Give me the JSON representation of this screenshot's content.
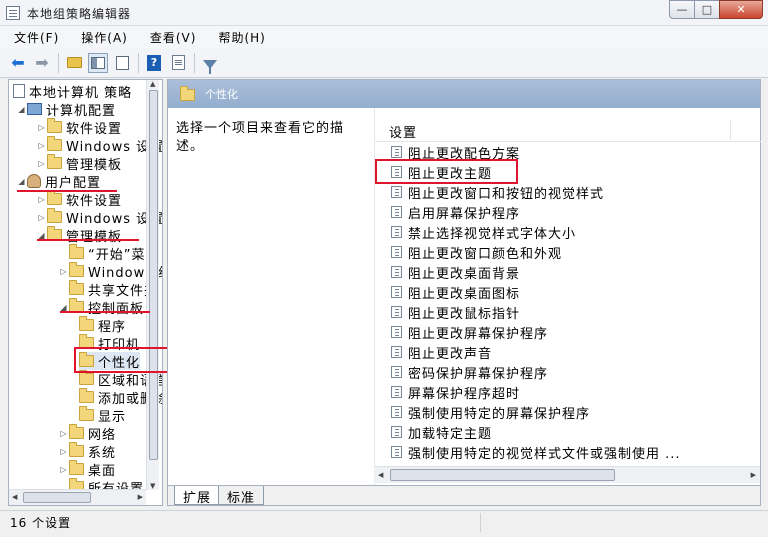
{
  "window": {
    "title": "本地组策略编辑器",
    "min_label": "—",
    "max_label": "□",
    "close_label": "✕"
  },
  "menubar": [
    "文件(F)",
    "操作(A)",
    "查看(V)",
    "帮助(H)"
  ],
  "toolbar": {
    "icons": [
      "back-arrow-icon",
      "forward-arrow-icon",
      "folder-up-icon",
      "show-hide-tree-icon",
      "export-list-icon",
      "help-icon",
      "properties-icon",
      "filter-icon"
    ]
  },
  "tree": {
    "items": [
      {
        "label": "本地计算机 策略",
        "depth": 0,
        "icon": "policy-doc-icon",
        "expander": "collapsed"
      },
      {
        "label": "计算机配置",
        "depth": 1,
        "icon": "computer-icon",
        "expander": "expanded"
      },
      {
        "label": "软件设置",
        "depth": 2,
        "icon": "folder-icon",
        "expander": "collapsed"
      },
      {
        "label": "Windows 设置",
        "depth": 2,
        "icon": "folder-icon",
        "expander": "collapsed"
      },
      {
        "label": "管理模板",
        "depth": 2,
        "icon": "folder-icon",
        "expander": "collapsed"
      },
      {
        "label": "用户配置",
        "depth": 1,
        "icon": "user-icon",
        "expander": "expanded"
      },
      {
        "label": "软件设置",
        "depth": 2,
        "icon": "folder-icon",
        "expander": "collapsed"
      },
      {
        "label": "Windows 设置",
        "depth": 2,
        "icon": "folder-icon",
        "expander": "collapsed"
      },
      {
        "label": "管理模板",
        "depth": 2,
        "icon": "folder-icon",
        "expander": "expanded"
      },
      {
        "label": "“开始”菜单",
        "depth": 3,
        "icon": "folder-icon",
        "expander": "none"
      },
      {
        "label": "Windows 组件",
        "depth": 3,
        "icon": "folder-icon",
        "expander": "collapsed"
      },
      {
        "label": "共享文件夹",
        "depth": 3,
        "icon": "folder-icon",
        "expander": "none"
      },
      {
        "label": "控制面板",
        "depth": 3,
        "icon": "folder-icon",
        "expander": "expanded"
      },
      {
        "label": "程序",
        "depth": 4,
        "icon": "folder-icon",
        "expander": "none"
      },
      {
        "label": "打印机",
        "depth": 4,
        "icon": "folder-icon",
        "expander": "none"
      },
      {
        "label": "个性化",
        "depth": 4,
        "icon": "folder-icon",
        "expander": "none"
      },
      {
        "label": "区域和语言",
        "depth": 4,
        "icon": "folder-icon",
        "expander": "none"
      },
      {
        "label": "添加或删除程序",
        "depth": 4,
        "icon": "folder-icon",
        "expander": "none"
      },
      {
        "label": "显示",
        "depth": 4,
        "icon": "folder-icon",
        "expander": "none"
      },
      {
        "label": "网络",
        "depth": 3,
        "icon": "folder-icon",
        "expander": "collapsed"
      },
      {
        "label": "系统",
        "depth": 3,
        "icon": "folder-icon",
        "expander": "collapsed"
      },
      {
        "label": "桌面",
        "depth": 3,
        "icon": "folder-icon",
        "expander": "collapsed"
      },
      {
        "label": "所有设置",
        "depth": 3,
        "icon": "folder-icon",
        "expander": "none"
      }
    ]
  },
  "main": {
    "header_title": "个性化",
    "description": "选择一个项目来查看它的描述。",
    "column_header": "设置",
    "settings": [
      "阻止更改配色方案",
      "阻止更改主题",
      "阻止更改窗口和按钮的视觉样式",
      "启用屏幕保护程序",
      "禁止选择视觉样式字体大小",
      "阻止更改窗口颜色和外观",
      "阻止更改桌面背景",
      "阻止更改桌面图标",
      "阻止更改鼠标指针",
      "阻止更改屏幕保护程序",
      "阻止更改声音",
      "密码保护屏幕保护程序",
      "屏幕保护程序超时",
      "强制使用特定的屏幕保护程序",
      "加载特定主题",
      "强制使用特定的视觉样式文件或强制使用 ..."
    ],
    "tabs": [
      "扩展",
      "标准"
    ]
  },
  "status": {
    "text": "16 个设置"
  },
  "colors": {
    "highlight_red": "#e0142c",
    "header_blue": "#95aecf",
    "folder_yellow": "#f3d57a"
  }
}
